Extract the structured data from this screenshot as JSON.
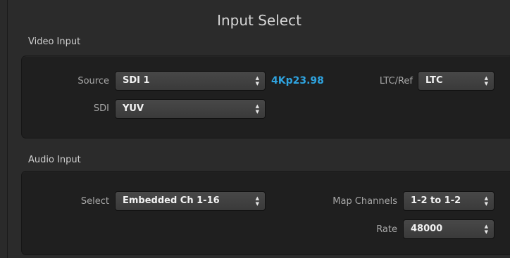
{
  "title": "Input Select",
  "video": {
    "section_label": "Video Input",
    "source_label": "Source",
    "source_value": "SDI 1",
    "detected_format": "4Kp23.98",
    "sdi_label": "SDI",
    "sdi_value": "YUV",
    "ltc_label": "LTC/Ref",
    "ltc_value": "LTC"
  },
  "audio": {
    "section_label": "Audio Input",
    "select_label": "Select",
    "select_value": "Embedded Ch 1-16",
    "map_label": "Map Channels",
    "map_value": "1-2 to 1-2",
    "rate_label": "Rate",
    "rate_value": "48000"
  },
  "icons": {
    "dropdown": "updown-arrows-icon"
  },
  "colors": {
    "format_text": "#2fa4e0",
    "background": "#2b2b2b",
    "panel": "#1f1f1f"
  }
}
